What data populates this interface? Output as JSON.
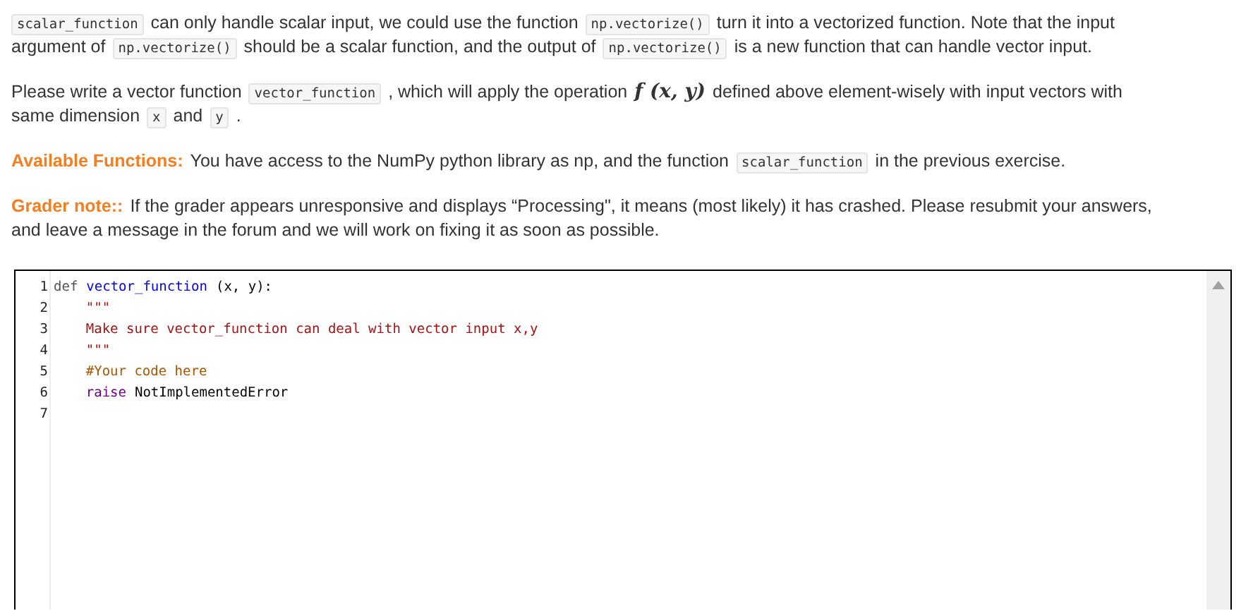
{
  "paragraphs": [
    {
      "lines": [
        [
          {
            "kind": "code",
            "text": "scalar_function"
          },
          {
            "kind": "text",
            "text": "can only handle scalar input, we could use the function"
          },
          {
            "kind": "code",
            "text": "np.vectorize()"
          },
          {
            "kind": "text",
            "text": "turn it into a vectorized function. Note that the input"
          }
        ],
        [
          {
            "kind": "text",
            "text": "argument of"
          },
          {
            "kind": "code",
            "text": "np.vectorize()"
          },
          {
            "kind": "text",
            "text": "should be a scalar function, and the output of"
          },
          {
            "kind": "code",
            "text": "np.vectorize()"
          },
          {
            "kind": "text",
            "text": "is a new function that can handle vector input."
          }
        ]
      ]
    },
    {
      "lines": [
        [
          {
            "kind": "text",
            "text": "Please write a vector function"
          },
          {
            "kind": "code",
            "text": "vector_function"
          },
          {
            "kind": "text",
            "text": ", which will apply the operation"
          },
          {
            "kind": "math",
            "text": "f (x, y)"
          },
          {
            "kind": "text",
            "text": "defined above element-wisely with input vectors with"
          }
        ],
        [
          {
            "kind": "text",
            "text": "same dimension"
          },
          {
            "kind": "code",
            "text": "x"
          },
          {
            "kind": "text",
            "text": "and"
          },
          {
            "kind": "code",
            "text": "y"
          },
          {
            "kind": "text",
            "text": "."
          }
        ]
      ]
    },
    {
      "lines": [
        [
          {
            "kind": "label",
            "text": "Available Functions:"
          },
          {
            "kind": "text",
            "text": "You have access to the NumPy python library as np, and the function"
          },
          {
            "kind": "code",
            "text": "scalar_function"
          },
          {
            "kind": "text",
            "text": "in the previous exercise."
          }
        ]
      ]
    },
    {
      "lines": [
        [
          {
            "kind": "label",
            "text": "Grader note::"
          },
          {
            "kind": "text",
            "text": "If the grader appears unresponsive and displays “Processing\", it means (most likely) it has crashed. Please resubmit your answers,"
          }
        ],
        [
          {
            "kind": "text",
            "text": "and leave a message in the forum and we will work on fixing it as soon as possible."
          }
        ]
      ]
    }
  ],
  "editor": {
    "lines": [
      {
        "number": "1",
        "tokens": [
          {
            "kind": "keyword",
            "text": "def"
          },
          {
            "kind": "def",
            "text": "vector_function"
          },
          {
            "kind": "plain",
            "text": "(x, y):"
          }
        ]
      },
      {
        "number": "2",
        "tokens": [
          {
            "kind": "string",
            "text": "    \"\"\""
          }
        ]
      },
      {
        "number": "3",
        "tokens": [
          {
            "kind": "string",
            "text": "    Make sure vector_function can deal with vector input x,y"
          }
        ]
      },
      {
        "number": "4",
        "tokens": [
          {
            "kind": "string",
            "text": "    \"\"\""
          }
        ]
      },
      {
        "number": "5",
        "tokens": [
          {
            "kind": "comment",
            "text": "    #Your code here"
          }
        ]
      },
      {
        "number": "6",
        "tokens": [
          {
            "kind": "keyword2",
            "text": "    raise"
          },
          {
            "kind": "plain",
            "text": "NotImplementedError"
          }
        ]
      },
      {
        "number": "7"
      }
    ]
  }
}
